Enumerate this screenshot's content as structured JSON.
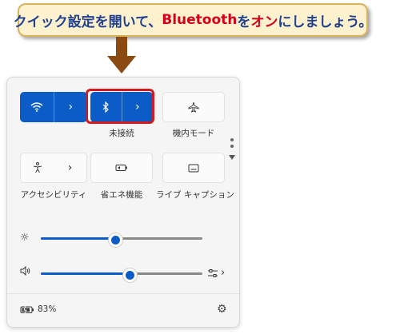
{
  "callout": {
    "part1": "クイック設定を開いて、",
    "part2": "Bluetooth",
    "part3": "を",
    "part4": "オン",
    "part5": "にしましょう。"
  },
  "tiles": {
    "wifi": {
      "icon": "wifi-icon",
      "chevron": "›",
      "state": "on"
    },
    "bluetooth": {
      "icon": "bluetooth-icon",
      "chevron": "›",
      "state": "on",
      "label": "未接続"
    },
    "airplane": {
      "icon": "airplane-icon",
      "label": "機内モード"
    },
    "accessibility": {
      "icon": "accessibility-icon",
      "chevron": "›",
      "label": "アクセシビリティ"
    },
    "battery_saver": {
      "icon": "battery-saver-icon",
      "label": "省エネ機能"
    },
    "live_caption": {
      "icon": "live-caption-icon",
      "label": "ライブ キャプション"
    }
  },
  "brightness": {
    "icon": "brightness-icon",
    "level_percent": 46
  },
  "volume": {
    "icon": "speaker-icon",
    "level_percent": 55,
    "mixer_chevron": "›"
  },
  "battery": {
    "icon": "battery-icon",
    "percent": "83%"
  },
  "settings": {
    "icon": "gear-icon"
  },
  "colors": {
    "accent": "#0b5cc7",
    "highlight": "#d6181f"
  }
}
